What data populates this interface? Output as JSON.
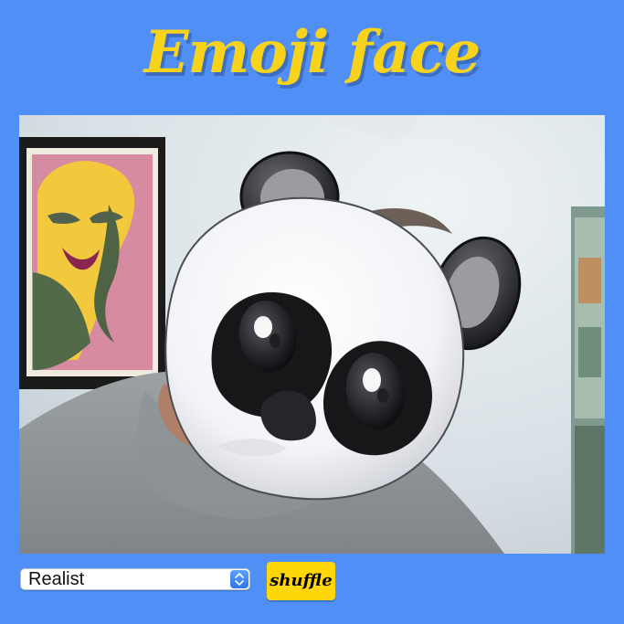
{
  "app": {
    "title": "Emoji face"
  },
  "camera": {
    "emoji_overlay": "panda-face"
  },
  "controls": {
    "mode_select": {
      "value": "Realist"
    },
    "shuffle_label": "shuffle"
  },
  "colors": {
    "background": "#4f8ff6",
    "title": "#f7d31c",
    "button": "#ffd60a",
    "select_arrow": "#2f74e8"
  },
  "icons": {
    "select": [
      "chevron-up-icon",
      "chevron-down-icon"
    ]
  }
}
